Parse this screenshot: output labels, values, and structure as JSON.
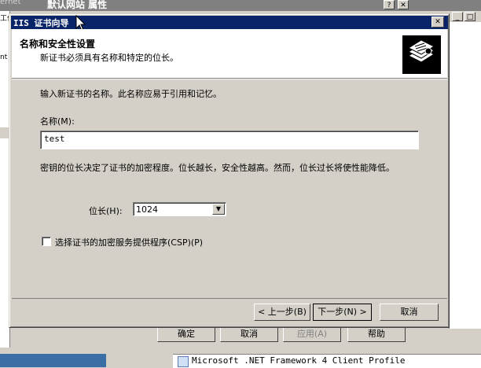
{
  "background": {
    "window_title": "默认网站 属性",
    "left_clip_text": "ernet",
    "left_panel_text_a": "工作",
    "left_panel_text_b": "nt",
    "help_btn": "?",
    "close_btn": "✕",
    "minimize_btn": "_",
    "maximize_btn": "□",
    "buttons": {
      "ok": "确定",
      "cancel": "取消",
      "apply": "应用(A)",
      "help": "帮助"
    },
    "list_item": "Microsoft .NET Framework 4 Client Profile"
  },
  "dialog": {
    "title": "IIS 证书向导",
    "close_glyph": "✕",
    "header_title": "名称和安全性设置",
    "header_subtitle": "新证书必须具有名称和特定的位长。",
    "instruction": "输入新证书的名称。此名称应易于引用和记忆。",
    "name_label": "名称(M):",
    "name_value": "test",
    "bitlength_description": "密钥的位长决定了证书的加密程度。位长越长，安全性越高。然而，位长过长将使性能降低。",
    "bitlength_label": "位长(H):",
    "bitlength_value": "1024",
    "csp_checkbox_label": "选择证书的加密服务提供程序(CSP)(P)",
    "csp_checked": false,
    "buttons": {
      "back": "< 上一步(B)",
      "next": "下一步(N) >",
      "cancel": "取消"
    },
    "colors": {
      "titlebar": "#0a246a",
      "face": "#d4d0c8"
    }
  }
}
